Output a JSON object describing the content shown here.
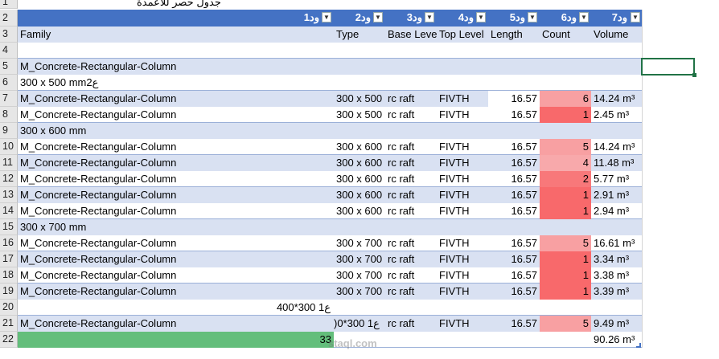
{
  "title": "جدول حصر للاعمدة",
  "headers": [
    "ود1",
    "ود2",
    "ود3",
    "ود4",
    "ود5",
    "ود6",
    "ود7"
  ],
  "columns": [
    "Family",
    "Type",
    "Base Leve",
    "Top Level",
    "Length",
    "Count",
    "Volume"
  ],
  "row_numbers": [
    "1",
    "2",
    "3",
    "4",
    "5",
    "6",
    "7",
    "8",
    "9",
    "10",
    "11",
    "12",
    "13",
    "14",
    "15",
    "16",
    "17",
    "18",
    "19",
    "20",
    "21",
    "22"
  ],
  "rows": {
    "r5": {
      "family": "M_Concrete-Rectangular-Column"
    },
    "r6": {
      "family": "300 x 500 mm2ع"
    },
    "r7": {
      "family": "M_Concrete-Rectangular-Column",
      "type": "300 x 500 r",
      "base": "rc raft",
      "top": "FIVTH",
      "length": "16.57",
      "count": "6",
      "volume": "14.24 m³"
    },
    "r8": {
      "family": "M_Concrete-Rectangular-Column",
      "type": "300 x 500 r",
      "base": "rc raft",
      "top": "FIVTH",
      "length": "16.57",
      "count": "1",
      "volume": "2.45 m³"
    },
    "r9": {
      "family": "300 x 600 mm"
    },
    "r10": {
      "family": "M_Concrete-Rectangular-Column",
      "type": "300 x 600 r",
      "base": "rc raft",
      "top": "FIVTH",
      "length": "16.57",
      "count": "5",
      "volume": "14.24 m³"
    },
    "r11": {
      "family": "M_Concrete-Rectangular-Column",
      "type": "300 x 600 r",
      "base": "rc raft",
      "top": "FIVTH",
      "length": "16.57",
      "count": "4",
      "volume": "11.48 m³"
    },
    "r12": {
      "family": "M_Concrete-Rectangular-Column",
      "type": "300 x 600 r",
      "base": "rc raft",
      "top": "FIVTH",
      "length": "16.57",
      "count": "2",
      "volume": "5.77 m³"
    },
    "r13": {
      "family": "M_Concrete-Rectangular-Column",
      "type": "300 x 600 r",
      "base": "rc raft",
      "top": "FIVTH",
      "length": "16.57",
      "count": "1",
      "volume": "2.91 m³"
    },
    "r14": {
      "family": "M_Concrete-Rectangular-Column",
      "type": "300 x 600 r",
      "base": "rc raft",
      "top": "FIVTH",
      "length": "16.57",
      "count": "1",
      "volume": "2.94 m³"
    },
    "r15": {
      "family": "300 x 700 mm"
    },
    "r16": {
      "family": "M_Concrete-Rectangular-Column",
      "type": "300 x 700 r",
      "base": "rc raft",
      "top": "FIVTH",
      "length": "16.57",
      "count": "5",
      "volume": "16.61 m³"
    },
    "r17": {
      "family": "M_Concrete-Rectangular-Column",
      "type": "300 x 700 r",
      "base": "rc raft",
      "top": "FIVTH",
      "length": "16.57",
      "count": "1",
      "volume": "3.34 m³"
    },
    "r18": {
      "family": "M_Concrete-Rectangular-Column",
      "type": "300 x 700 r",
      "base": "rc raft",
      "top": "FIVTH",
      "length": "16.57",
      "count": "1",
      "volume": "3.38 m³"
    },
    "r19": {
      "family": "M_Concrete-Rectangular-Column",
      "type": "300 x 700 r",
      "base": "rc raft",
      "top": "FIVTH",
      "length": "16.57",
      "count": "1",
      "volume": "3.39 m³"
    },
    "r20": {
      "family": "400*300 1ع"
    },
    "r21": {
      "family": "M_Concrete-Rectangular-Column",
      "type": ")0*300 1ع",
      "base": "rc raft",
      "top": "FIVTH",
      "length": "16.57",
      "count": "5",
      "volume": "9.49 m³"
    },
    "r22": {
      "total_count": "33",
      "total_volume": "90.26 m³"
    }
  },
  "watermark": "staql.com",
  "colors": {
    "header_blue": "#4472c4",
    "band": "#d9e1f2",
    "count_high": "#f8a0a2",
    "count_low": "#f8696b",
    "total_green": "#63be7b",
    "selection": "#217346"
  }
}
